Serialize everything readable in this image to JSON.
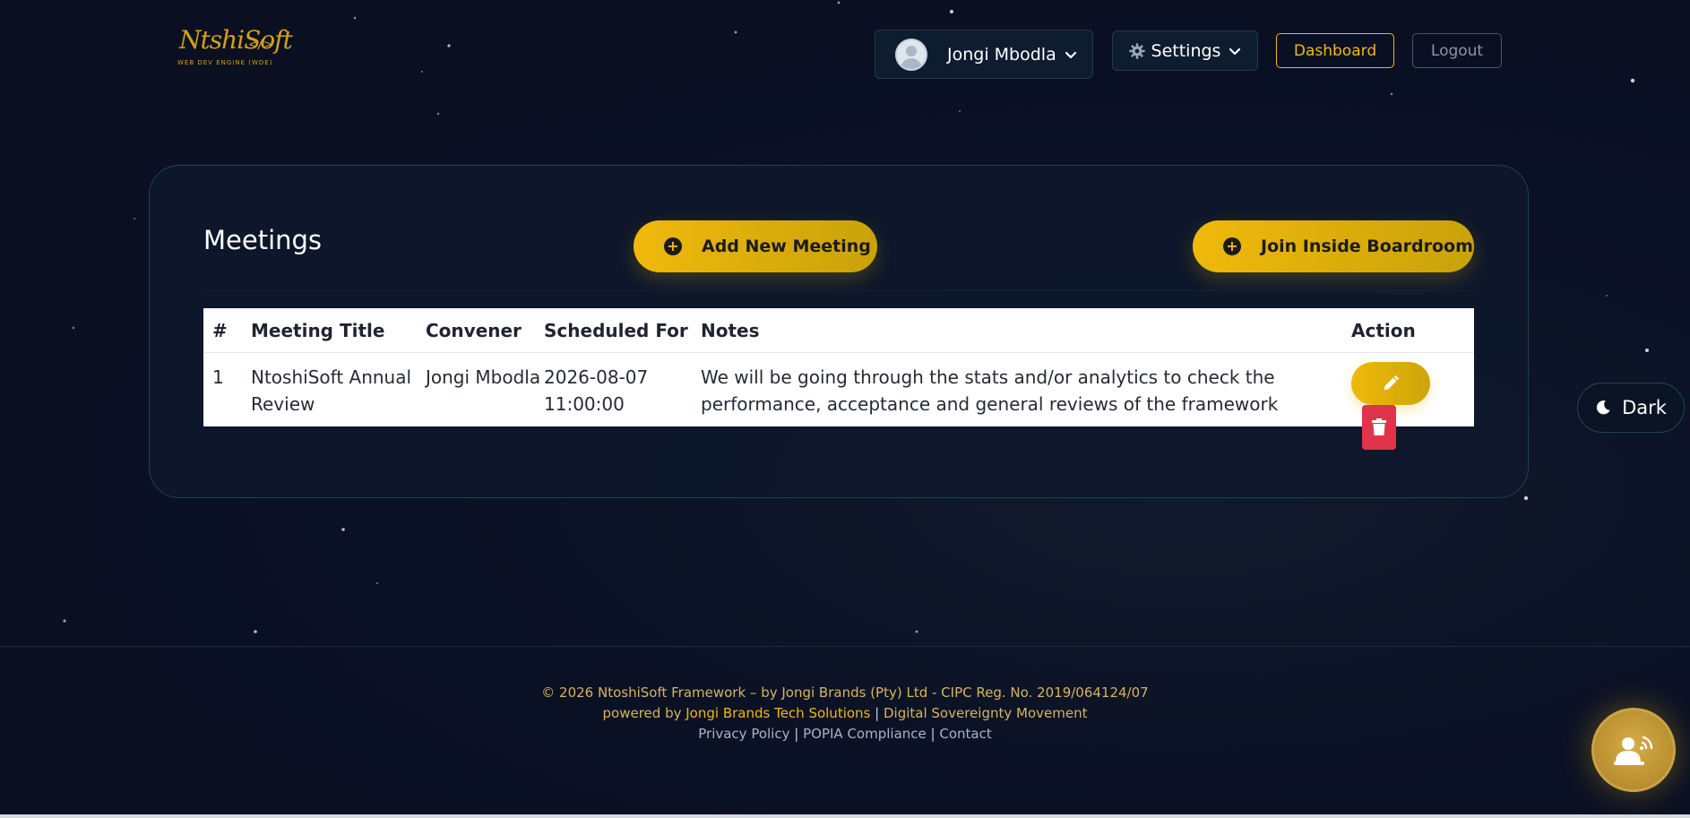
{
  "brand": {
    "logo_text": "NtshiSoft",
    "logo_code": "</>",
    "logo_subtitle": "WEB DEV ENGINE (WDE)"
  },
  "header": {
    "user_name": "Jongi Mbodla",
    "settings_label": "Settings",
    "dashboard_label": "Dashboard",
    "logout_label": "Logout"
  },
  "meetings": {
    "title": "Meetings",
    "add_button": "Add New Meeting",
    "join_button": "Join Inside Boardroom",
    "columns": [
      "#",
      "Meeting Title",
      "Convener",
      "Scheduled For",
      "Notes",
      "Action"
    ],
    "rows": [
      {
        "num": "1",
        "title": "NtoshiSoft Annual Review",
        "convener": "Jongi Mbodla",
        "scheduled": "2026-08-07 11:00:00",
        "notes": "We will be going through the stats and/or analytics to check the performance, acceptance and general reviews of the framework"
      }
    ]
  },
  "theme_toggle": {
    "label": "Dark"
  },
  "footer": {
    "copyright": "© 2026 NtoshiSoft Framework – by Jongi Brands (Pty) Ltd - CIPC Reg. No. 2019/064124/07",
    "powered_prefix": "powered by",
    "powered_link": "Jongi Brands Tech Solutions",
    "movement": "Digital Sovereignty Movement",
    "privacy": "Privacy Policy",
    "popia": "POPIA Compliance",
    "contact": "Contact"
  },
  "colors": {
    "accent": "#f0b90b",
    "danger": "#e0344a",
    "background": "#0a1022"
  },
  "icons": [
    "user-avatar-icon",
    "chevron-down-icon",
    "gear-icon",
    "plus-circle-icon",
    "pencil-icon",
    "trash-icon",
    "moon-icon",
    "broadcast-person-icon"
  ]
}
